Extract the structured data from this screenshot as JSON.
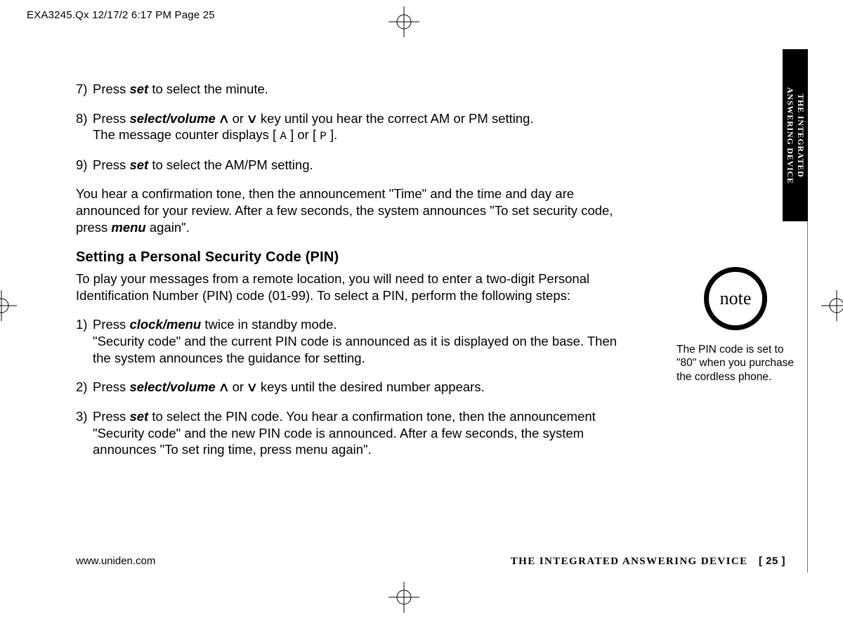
{
  "slug": "EXA3245.Qx  12/17/2  6:17 PM  Page 25",
  "sidetab_line1": "THE INTEGRATED",
  "sidetab_line2": "ANSWERING DEVICE",
  "steps_a": {
    "s7": {
      "n": "7)",
      "pre": "Press ",
      "key": "set",
      "post": " to select the minute."
    },
    "s8": {
      "n": "8)",
      "pre": "Press ",
      "key": "select/volume",
      "mid1": "  or  ",
      "tail": " key until you hear the correct AM or PM setting.",
      "line2_a": "The message counter displays [ ",
      "seg_a": "A",
      "line2_b": " ] or [ ",
      "seg_p": "P",
      "line2_c": " ]."
    },
    "s9": {
      "n": "9)",
      "pre": "Press ",
      "key": "set",
      "post": " to select the AM/PM setting."
    }
  },
  "para_confirm_a": "You hear a confirmation tone, then the announcement \"Time\" and the time and day are announced for your review. After a few seconds, the system announces \"To set security code, press ",
  "para_confirm_key": "menu",
  "para_confirm_b": " again\".",
  "h3": "Setting a Personal Security Code (PIN)",
  "intro": "To play your messages from a remote location, you will need to enter a two-digit Personal Identification Number (PIN) code (01-99). To select a PIN, perform the following steps:",
  "steps_b": {
    "s1": {
      "n": "1)",
      "pre": "Press ",
      "key": "clock/menu",
      "post": " twice in standby mode.",
      "line2": "\"Security code\" and the current PIN code is announced as it is displayed on the base. Then the system announces the guidance for setting."
    },
    "s2": {
      "n": "2)",
      "pre": "Press ",
      "key": "select/volume",
      "mid1": "  or  ",
      "post": " keys until the desired number appears."
    },
    "s3": {
      "n": "3)",
      "pre": "Press ",
      "key": "set",
      "post": " to select the PIN code. You hear a confirmation tone, then the announcement \"Security code\" and the new PIN code is announced. After a few seconds, the system announces \"To set ring time, press menu again\"."
    }
  },
  "note_label": "note",
  "note_text": "The PIN code is set to \"80\" when you purchase the cordless phone.",
  "footer_url": "www.uniden.com",
  "footer_title": "THE INTEGRATED ANSWERING DEVICE",
  "footer_page": "[ 25 ]"
}
